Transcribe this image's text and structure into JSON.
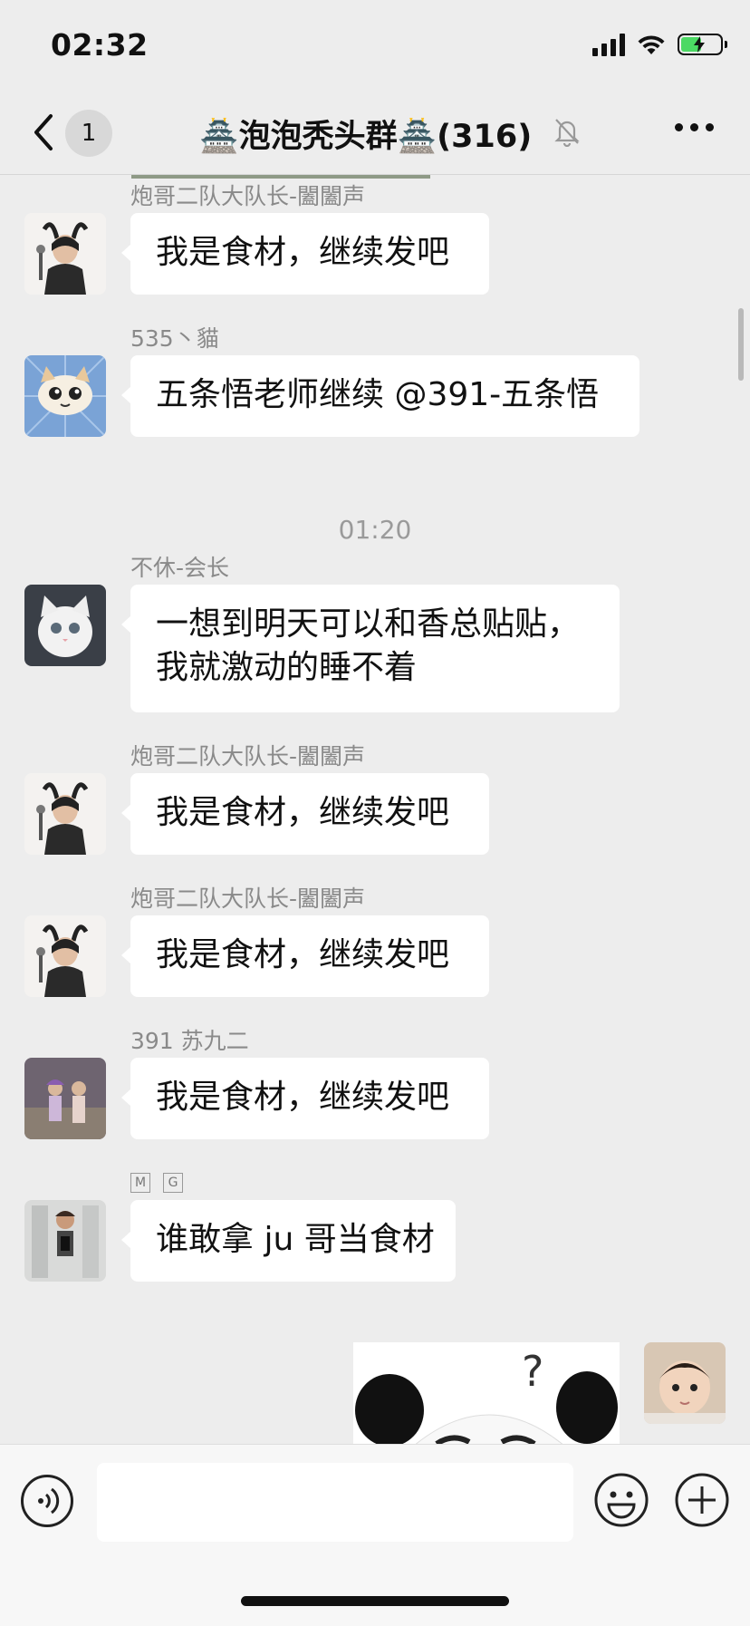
{
  "status_bar": {
    "time": "02:32"
  },
  "nav": {
    "back_badge": "1",
    "title": "🏯泡泡秃头群🏯(316)",
    "back_icon": "chevron-left-icon",
    "mute_icon": "bell-slash-icon",
    "more_icon": "ellipsis-icon"
  },
  "messages": [
    {
      "sender": "炮哥二队大队长-闔闔声",
      "text": "我是食材，继续发吧"
    },
    {
      "sender": "535丶貓",
      "text": "五条悟老师继续 @391-五条悟"
    },
    {
      "sender": "不休-会长",
      "text_line1": "一想到明天可以和香总贴贴，",
      "text_line2": "我就激动的睡不着"
    },
    {
      "sender": "炮哥二队大队长-闔闔声",
      "text": "我是食材，继续发吧"
    },
    {
      "sender": "炮哥二队大队长-闔闔声",
      "text": "我是食材，继续发吧"
    },
    {
      "sender": "391 苏九二",
      "text": "我是食材，继续发吧"
    },
    {
      "sender_tag1": "M",
      "sender_tag2": "G",
      "text": "谁敢拿 ju 哥当食材"
    }
  ],
  "time_divider": "01:20",
  "sticker": {
    "alt": "panda-meme-sticker"
  },
  "input_bar": {
    "placeholder": "",
    "voice_icon": "voice-icon",
    "emoji_icon": "emoji-icon",
    "plus_icon": "plus-icon"
  }
}
